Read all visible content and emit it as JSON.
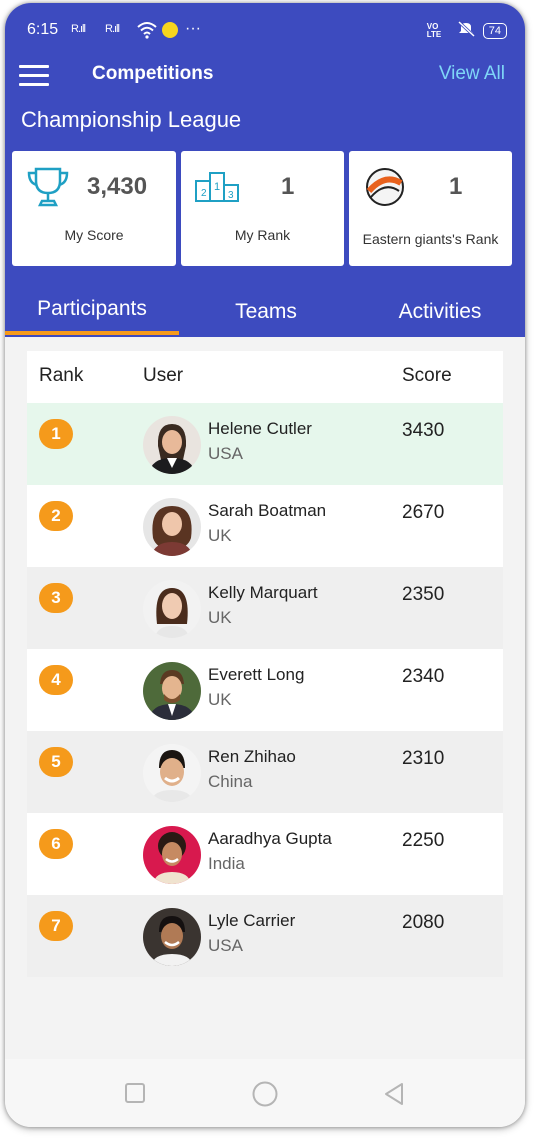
{
  "status_bar": {
    "time": "6:15",
    "signal1": "R.ıll",
    "signal2": "R.ıll",
    "extra": "···",
    "volte": "VO LTE",
    "battery": "74"
  },
  "header": {
    "title": "Competitions",
    "view_all": "View All",
    "league_name": "Championship League"
  },
  "cards": {
    "score": {
      "value": "3,430",
      "label": "My Score",
      "icon": "trophy-icon"
    },
    "rank": {
      "value": "1",
      "label": "My Rank",
      "icon": "podium-icon"
    },
    "team_rank": {
      "value": "1",
      "label": "Eastern giants's Rank",
      "icon": "team-logo-icon"
    }
  },
  "tabs": [
    {
      "label": "Participants",
      "active": true
    },
    {
      "label": "Teams",
      "active": false
    },
    {
      "label": "Activities",
      "active": false
    }
  ],
  "table": {
    "headers": {
      "rank": "Rank",
      "user": "User",
      "score": "Score"
    },
    "rows": [
      {
        "rank": "1",
        "name": "Helene Cutler",
        "country": "USA",
        "score": "3430"
      },
      {
        "rank": "2",
        "name": "Sarah Boatman",
        "country": "UK",
        "score": "2670"
      },
      {
        "rank": "3",
        "name": "Kelly Marquart",
        "country": "UK",
        "score": "2350"
      },
      {
        "rank": "4",
        "name": "Everett Long",
        "country": "UK",
        "score": "2340"
      },
      {
        "rank": "5",
        "name": "Ren Zhihao",
        "country": "China",
        "score": "2310"
      },
      {
        "rank": "6",
        "name": "Aaradhya Gupta",
        "country": "India",
        "score": "2250"
      },
      {
        "rank": "7",
        "name": "Lyle Carrier",
        "country": "USA",
        "score": "2080"
      }
    ]
  },
  "colors": {
    "header_bg": "#3d4bbf",
    "accent": "#f59a1b",
    "highlight_row": "#e6f7ec",
    "alt_row": "#efefef",
    "link": "#7fd6f7"
  }
}
